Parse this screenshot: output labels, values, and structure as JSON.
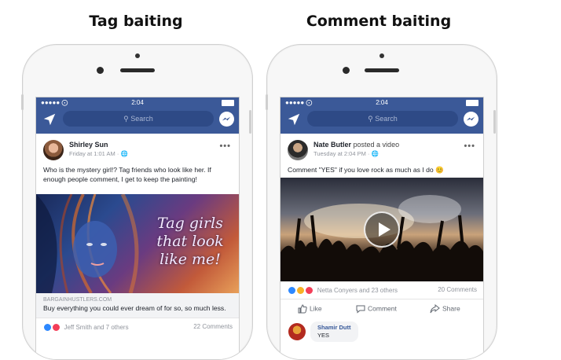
{
  "headings": {
    "left": "Tag baiting",
    "right": "Comment baiting"
  },
  "status_bar": {
    "dots": "●●●●● ⨀",
    "time": "2:04"
  },
  "search": {
    "placeholder": "Search"
  },
  "left_post": {
    "author": "Shirley Sun",
    "meta": "Friday at 1:01 AM ·",
    "more": "•••",
    "text": "Who is the mystery girl!? Tag friends who look like her. If enough people comment, I get to keep the painting!",
    "image_caption": "Tag girls that look like me!",
    "link_url": "BARGAINHUSTLERS.COM",
    "link_title": "Buy everything you could ever dream of for so, so much less.",
    "reactions_text": "Jeff Smith and 7 others",
    "comments_count": "22 Comments"
  },
  "right_post": {
    "author": "Nate Butler",
    "author_action": "posted a video",
    "meta": "Tuesday at 2:04 PM ·",
    "more": "•••",
    "text": "Comment \"YES\" if you love rock as much as I do 😊",
    "reactions_text": "Netta Conyers and 23 others",
    "comments_count": "20 Comments",
    "actions": {
      "like": "Like",
      "comment": "Comment",
      "share": "Share"
    },
    "comment": {
      "name": "Shamir Dutt",
      "text": "YES"
    }
  },
  "colors": {
    "facebook_blue": "#3b5998",
    "link_blue": "#365899",
    "like_blue": "#2d88ff",
    "love_red": "#f33e58",
    "haha_yellow": "#f7b125"
  },
  "icons": [
    "send-icon",
    "search-icon",
    "messenger-icon",
    "globe-icon",
    "like-icon",
    "comment-icon",
    "share-icon",
    "play-icon"
  ]
}
